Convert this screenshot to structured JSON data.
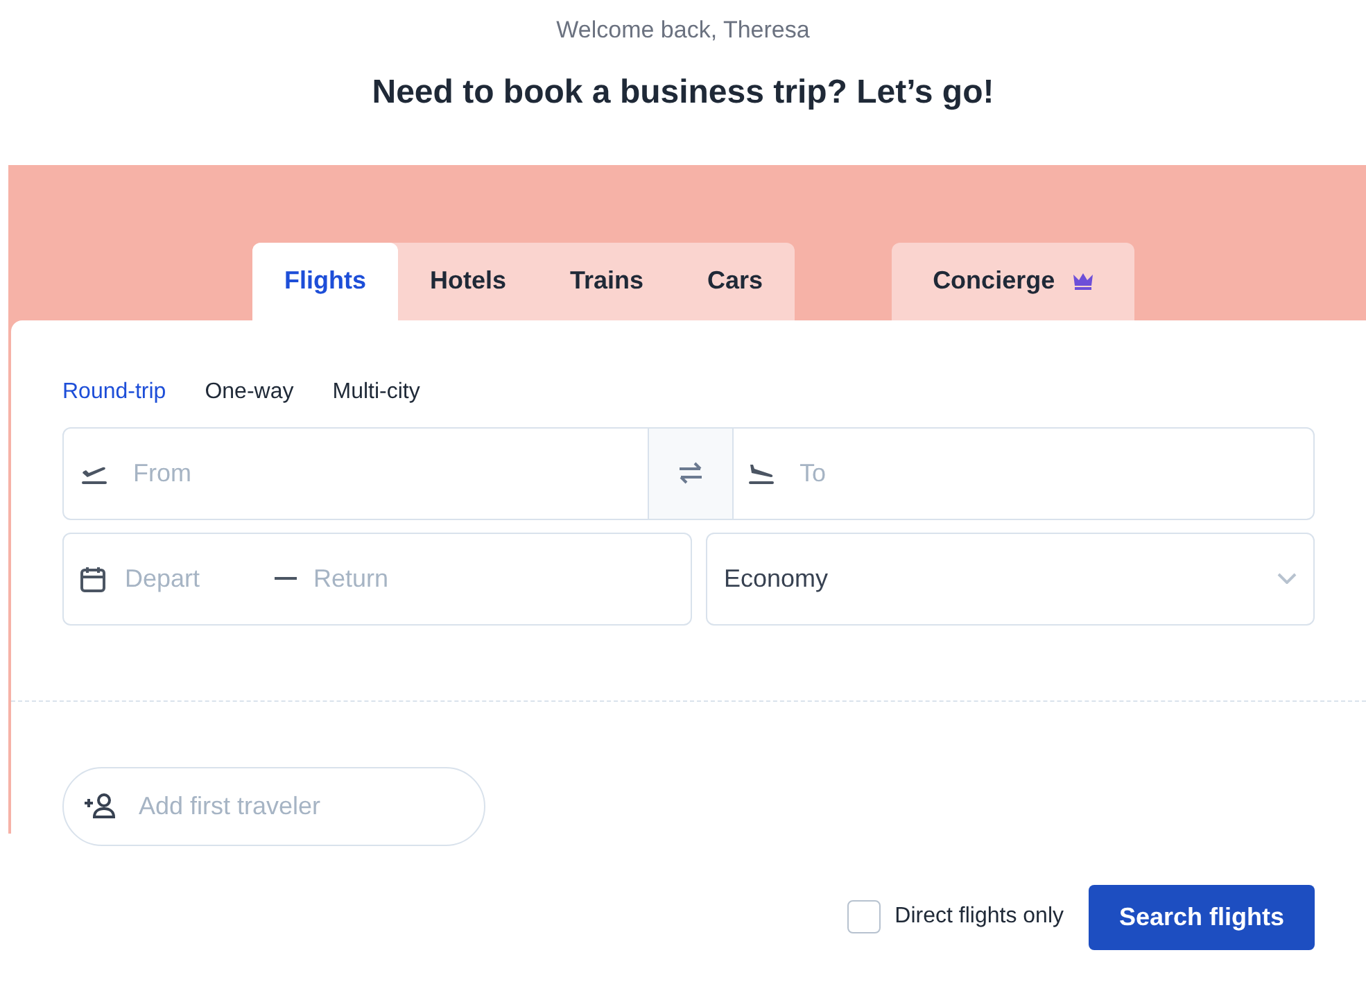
{
  "greeting": "Welcome back, Theresa",
  "title": "Need to book a business trip? Let’s go!",
  "tabs": [
    {
      "label": "Flights",
      "selected": true
    },
    {
      "label": "Hotels",
      "selected": false
    },
    {
      "label": "Trains",
      "selected": false
    },
    {
      "label": "Cars",
      "selected": false
    }
  ],
  "concierge_tab": {
    "label": "Concierge",
    "selected": false
  },
  "trip_types": [
    {
      "label": "Round-trip",
      "selected": true
    },
    {
      "label": "One-way",
      "selected": false
    },
    {
      "label": "Multi-city",
      "selected": false
    }
  ],
  "from": {
    "placeholder": "From"
  },
  "to": {
    "placeholder": "To"
  },
  "depart": {
    "placeholder": "Depart"
  },
  "return": {
    "placeholder": "Return"
  },
  "cabin": {
    "value": "Economy"
  },
  "traveler": {
    "placeholder": "Add first traveler"
  },
  "direct_only": {
    "label": "Direct flights only",
    "checked": false
  },
  "search_button": "Search flights"
}
